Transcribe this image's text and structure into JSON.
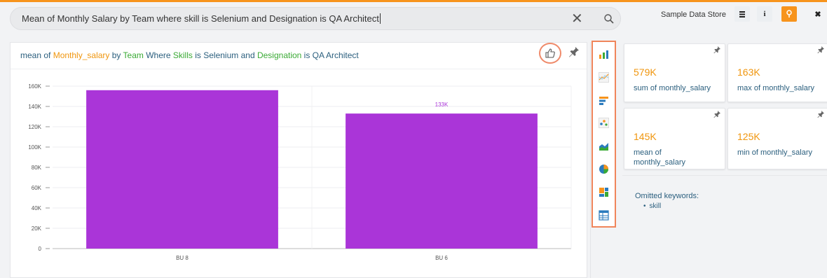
{
  "search": {
    "query": "Mean of Monthly Salary by Team where skill is Selenium and Designation is QA Architect",
    "clear_glyph": "✕"
  },
  "toolbar": {
    "store_label": "Sample Data Store",
    "buttons": [
      {
        "icon": "database-icon",
        "glyph": "≡"
      },
      {
        "icon": "info-icon",
        "glyph": "i"
      },
      {
        "icon": "location-pin-icon",
        "glyph": "♀"
      },
      {
        "icon": "close-icon",
        "glyph": "✖"
      }
    ]
  },
  "chart_title": {
    "p1": "mean of ",
    "k1": "Monthly_salary",
    "p2": " by ",
    "k2": "Team",
    "p3": " Where ",
    "k3": "Skills",
    "p4": " is Selenium and ",
    "k4": "Designation",
    "p5": " is QA Architect"
  },
  "chart_types": [
    "bar-chart-icon",
    "line-chart-icon",
    "horizontal-bar-icon",
    "scatter-icon",
    "area-chart-icon",
    "pie-chart-icon",
    "treemap-icon",
    "table-icon"
  ],
  "chart_data": {
    "type": "bar",
    "categories": [
      "BU 8",
      "BU 6"
    ],
    "values": [
      156000,
      133000
    ],
    "data_labels": [
      "",
      "133K"
    ],
    "ylim": [
      0,
      160000
    ],
    "yticks": [
      0,
      20000,
      40000,
      60000,
      80000,
      100000,
      120000,
      140000,
      160000
    ],
    "ytick_labels": [
      "0",
      "20K",
      "40K",
      "60K",
      "80K",
      "100K",
      "120K",
      "140K",
      "160K"
    ],
    "grid": true,
    "bar_color": "#aa35d8"
  },
  "cards": [
    {
      "value": "579K",
      "label": "sum of monthly_salary"
    },
    {
      "value": "163K",
      "label": "max of monthly_salary"
    },
    {
      "value": "145K",
      "label": "mean of monthly_salary"
    },
    {
      "value": "125K",
      "label": "min of monthly_salary"
    }
  ],
  "omitted": {
    "title": "Omitted keywords:",
    "items": [
      "skill"
    ]
  },
  "colors": {
    "accent": "#f7941d",
    "highlight_border": "#f0855b",
    "text_blue": "#2b5f7e",
    "keyword_green": "#3aaa35"
  }
}
